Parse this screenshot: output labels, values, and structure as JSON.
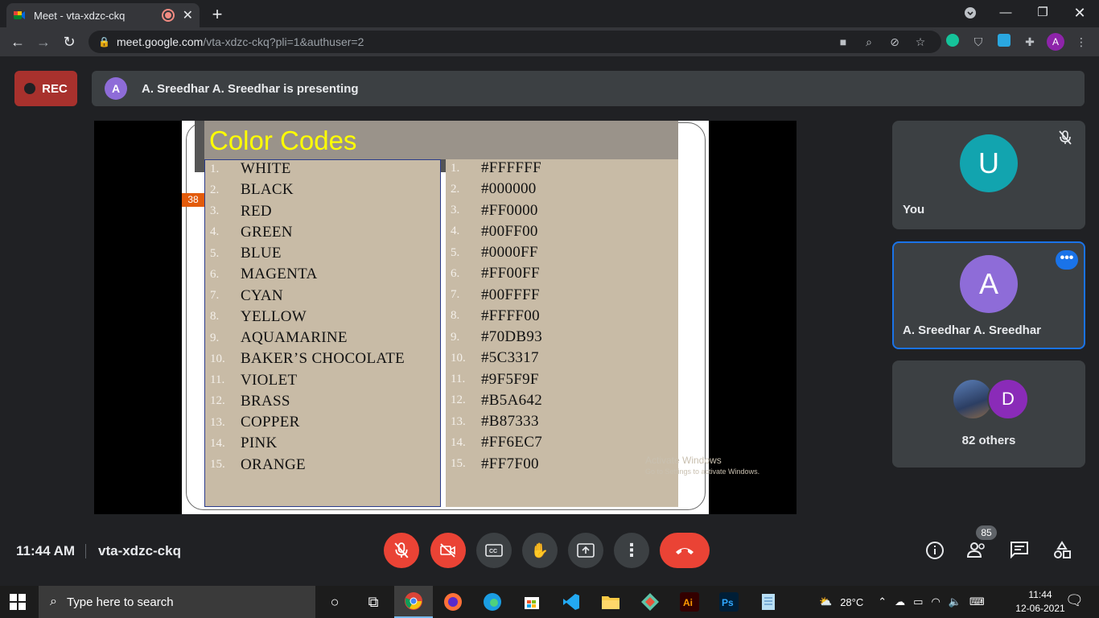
{
  "browser": {
    "tab_title": "Meet - vta-xdzc-ckq",
    "url_host": "meet.google.com",
    "url_path": "/vta-xdzc-ckq?pli=1&authuser=2",
    "profile_initial": "A"
  },
  "meet": {
    "rec_label": "REC",
    "presenter_initial": "A",
    "presenting_text": "A. Sreedhar A. Sreedhar is presenting",
    "tiles": [
      {
        "initial": "U",
        "name": "You",
        "color": "#12a4af"
      },
      {
        "initial": "A",
        "name": "A. Sreedhar A. Sreedhar",
        "color": "#8e6cd8"
      },
      {
        "initial": "D",
        "name": "82 others",
        "color": "#8a2bb8"
      }
    ],
    "clock": "11:44 AM",
    "meeting_code": "vta-xdzc-ckq",
    "participant_count": "85"
  },
  "slide": {
    "title": "Color Codes",
    "slide_number": "38",
    "names": [
      "WHITE",
      "BLACK",
      "RED",
      "GREEN",
      "BLUE",
      "MAGENTA",
      "CYAN",
      "YELLOW",
      "AQUAMARINE",
      "BAKER’S CHOCOLATE",
      "VIOLET",
      "BRASS",
      "COPPER",
      "PINK",
      "ORANGE"
    ],
    "codes": [
      "#FFFFFF",
      "#000000",
      "#FF0000",
      "#00FF00",
      "#0000FF",
      "#FF00FF",
      "#00FFFF",
      "#FFFF00",
      "#70DB93",
      "#5C3317",
      "#9F5F9F",
      "#B5A642",
      "#B87333",
      "#FF6EC7",
      "#FF7F00"
    ],
    "watermark_line1": "Activate Windows",
    "watermark_line2": "Go to Settings to activate Windows."
  },
  "taskbar": {
    "search_placeholder": "Type here to search",
    "temperature": "28°C",
    "time": "11:44",
    "date": "12-06-2021"
  }
}
